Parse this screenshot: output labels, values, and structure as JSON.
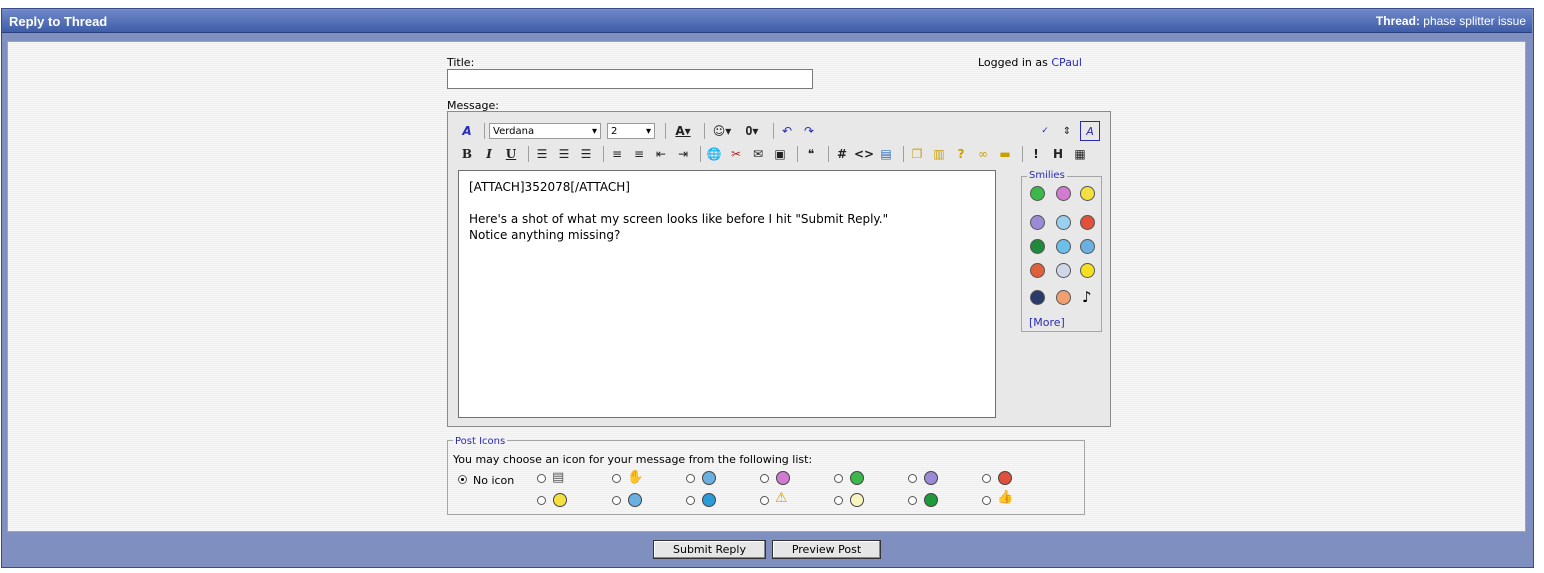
{
  "header": {
    "title": "Reply to Thread",
    "thread_label": "Thread:",
    "thread_name": "phase splitter issue"
  },
  "form": {
    "title_label": "Title:",
    "title_value": "",
    "logged_in_prefix": "Logged in as",
    "username": "CPaul",
    "message_label": "Message:"
  },
  "toolbar": {
    "font_name": "Verdana",
    "font_size": "2",
    "bold": "B",
    "italic": "I",
    "underline": "U",
    "hash": "#",
    "code": "<>"
  },
  "message": {
    "text": "[ATTACH]352078[/ATTACH]\n\nHere's a shot of what my screen looks like before I hit \"Submit Reply.\"\nNotice anything missing?"
  },
  "smilies": {
    "legend": "Smilies",
    "more": "[More]"
  },
  "post_icons": {
    "legend": "Post Icons",
    "instructions": "You may choose an icon for your message from the following list:",
    "no_icon": "No icon"
  },
  "buttons": {
    "submit": "Submit Reply",
    "preview": "Preview Post"
  },
  "colors": {
    "header": "#4a68b0",
    "link": "#2a2ab8"
  }
}
